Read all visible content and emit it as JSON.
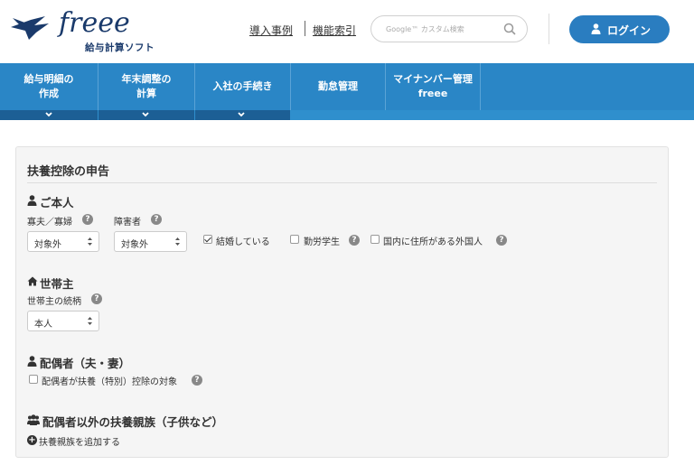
{
  "header": {
    "logo_text": "freee",
    "logo_sub": "給与計算ソフト",
    "links": [
      "導入事例",
      "機能索引"
    ],
    "search_placeholder": "Google™ カスタム検索",
    "login_label": "ログイン"
  },
  "nav": {
    "items": [
      {
        "line1": "給与明細の",
        "line2": "作成",
        "has_arrow": true
      },
      {
        "line1": "年末調整の",
        "line2": "計算",
        "has_arrow": true
      },
      {
        "line1": "入社の手続き",
        "line2": "",
        "has_arrow": true
      },
      {
        "line1": "勤怠管理",
        "line2": "",
        "has_arrow": false
      },
      {
        "line1": "マイナンバー管理",
        "line2": "freee",
        "has_arrow": false
      }
    ]
  },
  "form": {
    "title": "扶養控除の申告",
    "self": {
      "heading": "ご本人",
      "widow_label": "寡夫／寡婦",
      "widow_value": "対象外",
      "disability_label": "障害者",
      "disability_value": "対象外",
      "married_label": "結婚している",
      "married_checked": true,
      "student_label": "勤労学生",
      "student_checked": false,
      "foreign_label": "国内に住所がある外国人",
      "foreign_checked": false
    },
    "household": {
      "heading": "世帯主",
      "relation_label": "世帯主の続柄",
      "relation_value": "本人"
    },
    "spouse": {
      "heading": "配偶者（夫・妻）",
      "deduction_label": "配偶者が扶養（特別）控除の対象",
      "deduction_checked": false
    },
    "dependents": {
      "heading": "配偶者以外の扶養親族（子供など）",
      "add_label": "扶養親族を追加する"
    }
  },
  "colors": {
    "brand": "#1a3a6b",
    "nav": "#2a86c6",
    "nav_dark": "#1c5f95",
    "button": "#2a7dc0"
  }
}
